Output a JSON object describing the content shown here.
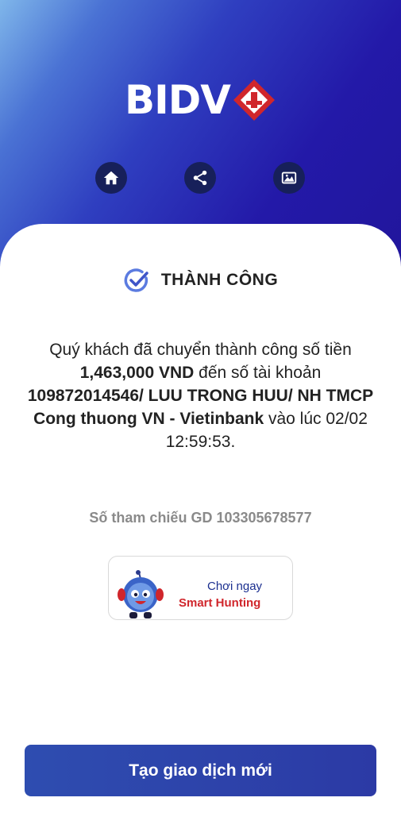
{
  "header": {
    "brand_text": "BIDV",
    "colors": {
      "gradient_dark": "#21169c",
      "gradient_light": "#7fb6ea",
      "logo_red": "#d0262c"
    },
    "actions": [
      {
        "icon": "home-icon"
      },
      {
        "icon": "share-icon"
      },
      {
        "icon": "image-icon"
      }
    ]
  },
  "result": {
    "status_label": "THÀNH CÔNG",
    "message_part1": "Quý khách đã chuyển thành công số tiền ",
    "amount": "1,463,000 VND",
    "message_part2": " đến số tài khoản ",
    "beneficiary": "109872014546/ LUU TRONG HUU/ NH TMCP Cong thuong VN - Vietinbank",
    "message_part3": " vào lúc 02/02 12:59:53.",
    "reference": "Số tham chiếu GD 103305678577"
  },
  "promo": {
    "line1": "Chơi ngay",
    "line2": "Smart Hunting"
  },
  "footer": {
    "new_transaction_label": "Tạo giao dịch mới"
  }
}
